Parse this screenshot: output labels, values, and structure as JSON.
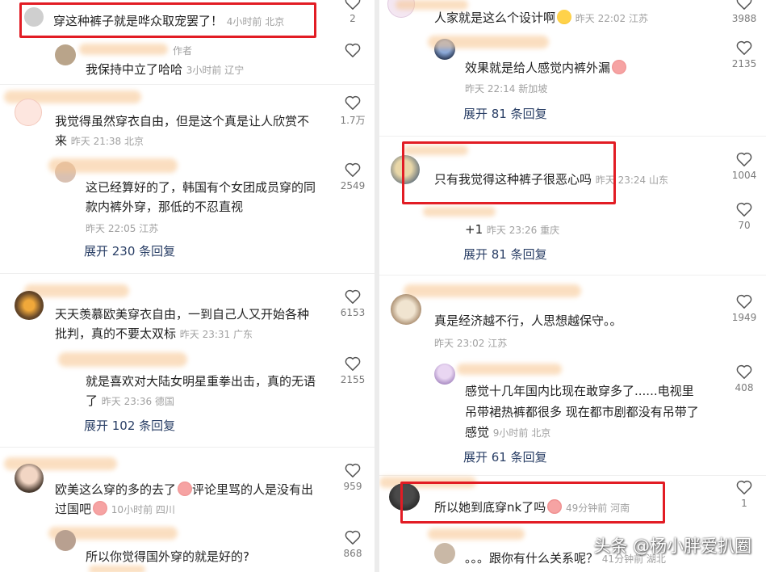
{
  "left": {
    "c0": {
      "text": "穿这种裤子就是哗众取宠罢了！",
      "meta": "4小时前 北京",
      "likes": "2"
    },
    "c0_reply": {
      "author_tag": "作者",
      "text": "我保持中立了哈哈",
      "meta": "3小时前 辽宁"
    },
    "c1": {
      "text_line1": "我觉得虽然穿衣自由，但是这个真是让人欣赏不",
      "text_line2": "来",
      "meta": "昨天 21:38 北京",
      "likes": "1.7万"
    },
    "c1_reply": {
      "text_line1": "这已经算好的了，韩国有个女团成员穿的同",
      "text_line2": "款内裤外穿，那低的不忍直视",
      "meta": "昨天 22:05 江苏",
      "likes": "2549"
    },
    "c1_expand": "展开 230 条回复",
    "c2": {
      "text_line1": "天天羡慕欧美穿衣自由，一到自己人又开始各种",
      "text_line2": "批判，真的不要太双标",
      "meta": "昨天 23:31 广东",
      "likes": "6153"
    },
    "c2_reply": {
      "text_line1": "就是喜欢对大陆女明星重拳出击，真的无语",
      "text_line2": "了",
      "meta": "昨天 23:36 德国",
      "likes": "2155"
    },
    "c2_expand": "展开 102 条回复",
    "c3": {
      "text_line1": "欧美这么穿的多的去了",
      "text_line1b": "评论里骂的人是没有出",
      "text_line2": "过国吧",
      "meta": "10小时前 四川",
      "likes": "959"
    },
    "c3_reply": {
      "text": "所以你觉得国外穿的就是好的?",
      "likes": "868"
    }
  },
  "right": {
    "r0": {
      "text": "人家就是这么个设计啊",
      "meta": "昨天 22:02 江苏",
      "likes": "3988"
    },
    "r0_reply": {
      "text": "效果就是给人感觉内裤外漏",
      "meta": "昨天 22:14 新加坡",
      "likes": "2135"
    },
    "r0_expand": "展开 81 条回复",
    "r1": {
      "text": "只有我觉得这种裤子很恶心吗",
      "meta": "昨天 23:24 山东",
      "likes": "1004"
    },
    "r1_reply": {
      "text": "+1",
      "meta": "昨天 23:26 重庆",
      "likes": "70"
    },
    "r1_expand": "展开 81 条回复",
    "r2": {
      "text": "真是经济越不行，人思想越保守。。",
      "meta": "昨天 23:02 江苏",
      "likes": "1949"
    },
    "r2_reply": {
      "text_line1": "感觉十几年国内比现在敢穿多了......电视里",
      "text_line2": "吊带裙热裤都很多 现在都市剧都没有吊带了",
      "text_line3": "感觉",
      "meta": "9小时前 北京",
      "likes": "408"
    },
    "r2_expand": "展开 61 条回复",
    "r3": {
      "text": "所以她到底穿nk了吗",
      "meta": "49分钟前 河南",
      "likes": "1"
    },
    "r3_reply": {
      "text": "。。。跟你有什么关系呢？",
      "meta": "41分钟前 湖北"
    }
  },
  "watermark": "头条 @杨小胖爱扒圈",
  "colors": {
    "highlight": "#e21c24",
    "meta": "#a0a0a0",
    "expand": "#2a3f66",
    "blur": "#f7c48d"
  }
}
